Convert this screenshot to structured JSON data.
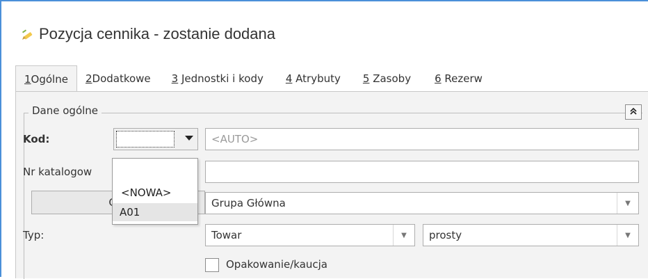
{
  "window": {
    "title": "Pozycja cennika - zostanie dodana",
    "title_icon": "edit-pencil-icon"
  },
  "tabs": [
    {
      "key": "1",
      "label": "Ogólne",
      "active": true
    },
    {
      "key": "2",
      "label": "Dodatkowe",
      "active": false
    },
    {
      "key": "3",
      "label": "Jednostki i kody",
      "active": false
    },
    {
      "key": "4",
      "label": "Atrybuty",
      "active": false
    },
    {
      "key": "5",
      "label": "Zasoby",
      "active": false
    },
    {
      "key": "6",
      "label": "Rezerw",
      "active": false
    }
  ],
  "group": {
    "label": "Dane ogólne",
    "collapse_icon": "double-chevron-up-icon"
  },
  "form": {
    "kod_label": "Kod:",
    "kod_value": "",
    "kod_auto_placeholder": "<AUTO>",
    "nr_katalogowy_label": "Nr katalogow",
    "nr_katalogowy_value": "",
    "grupa_button": "Gru",
    "grupa_value": "Grupa Główna",
    "typ_label": "Typ:",
    "typ_value": "Towar",
    "typ2_value": "prosty",
    "opakowanie_label": "Opakowanie/kaucja",
    "opakowanie_checked": false
  },
  "kod_dropdown": {
    "items": [
      {
        "label": ""
      },
      {
        "label": "<NOWA>"
      },
      {
        "label": "A01",
        "selected": true
      }
    ]
  }
}
